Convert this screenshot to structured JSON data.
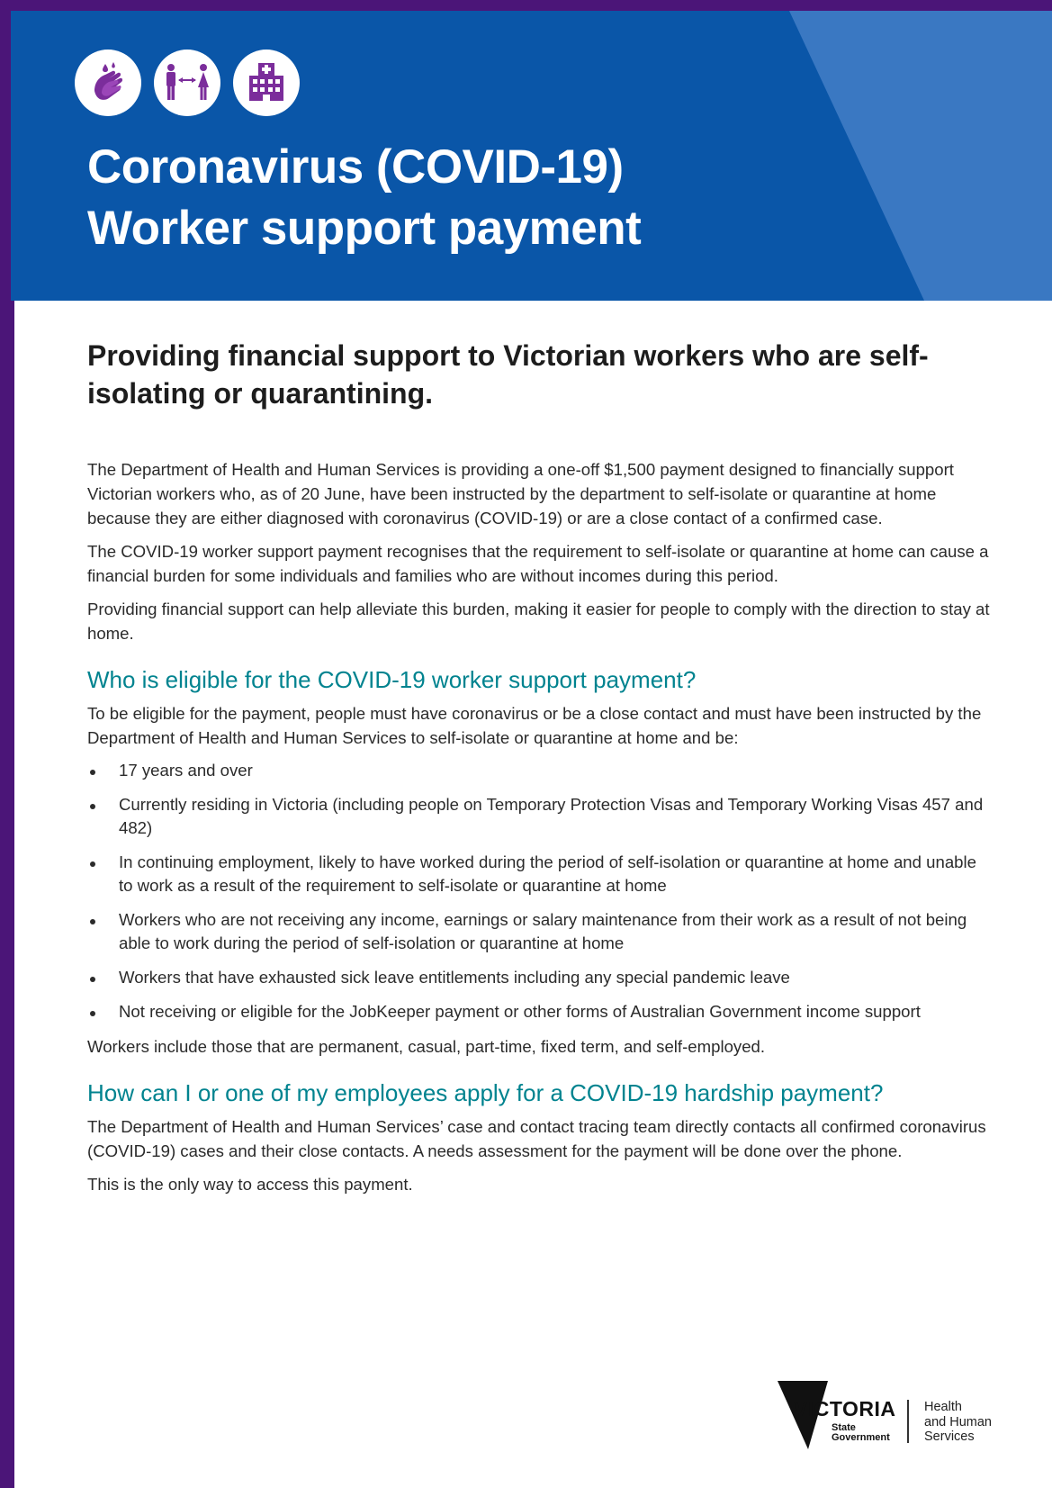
{
  "header": {
    "title_line1": "Coronavirus (COVID-19)",
    "title_line2": "Worker support payment",
    "icons": [
      "handwashing-icon",
      "social-distancing-icon",
      "hospital-icon"
    ],
    "colors": {
      "band": "#0a56a8",
      "stripe": "#3a78c2",
      "frame": "#4b1578",
      "icon": "#7b2d9b"
    }
  },
  "lead": "Providing financial support to Victorian workers who are self-isolating or quarantining.",
  "intro": [
    "The Department of Health and Human Services is providing a one-off $1,500 payment designed to financially support Victorian workers who, as of 20 June, have been instructed by the department to self-isolate or quarantine at home because they are either diagnosed with coronavirus (COVID-19) or are a close contact of a confirmed case.",
    "The COVID-19 worker support payment recognises that the requirement to self-isolate or quarantine at home can cause a financial burden for some individuals and families who are without incomes during this period.",
    "Providing financial support can help alleviate this burden, making it easier for people to comply with the direction to stay at home."
  ],
  "eligibility": {
    "heading": "Who is eligible for the COVID-19 worker support payment?",
    "intro": "To be eligible for the payment, people must have coronavirus or be a close contact and must have been instructed by the Department of Health and Human Services to self-isolate or quarantine at home and be:",
    "bullets": [
      "17 years and over",
      "Currently residing in Victoria (including people on Temporary Protection Visas and Temporary Working Visas 457 and 482)",
      "In continuing employment, likely to have worked during the period of self-isolation or quarantine at home and unable to work as a result of the requirement to self-isolate or quarantine at home",
      "Workers who are not receiving any income, earnings or salary maintenance from their work as a result of not being able to work during the period of self-isolation or quarantine at home",
      "Workers that have exhausted sick leave entitlements including any special pandemic leave",
      "Not receiving or eligible for the JobKeeper payment or other forms of Australian Government income support"
    ],
    "note": "Workers include those that are permanent, casual, part-time, fixed term, and self-employed."
  },
  "apply": {
    "heading": "How can I or one of my employees apply for a COVID-19 hardship payment?",
    "paragraphs": [
      "The Department of Health and Human Services’ case and contact tracing team directly contacts all confirmed coronavirus (COVID-19) cases and their close contacts. A needs assessment for the payment will be done over the phone.",
      "This is the only way to access this payment."
    ]
  },
  "footer": {
    "logo_word": "VICTORIA",
    "logo_sub1": "State",
    "logo_sub2": "Government",
    "dept_line1": "Health",
    "dept_line2": "and Human",
    "dept_line3": "Services"
  }
}
